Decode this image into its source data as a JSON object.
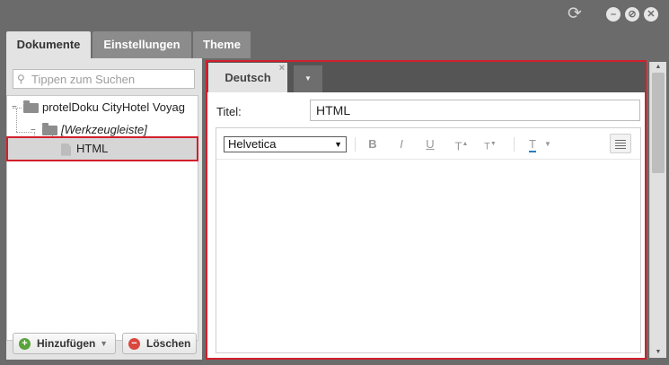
{
  "window": {
    "refresh_icon": "refresh-icon",
    "minimize_glyph": "–",
    "restore_glyph": "⊘",
    "close_glyph": "✕"
  },
  "tabs": [
    {
      "label": "Dokumente",
      "active": true
    },
    {
      "label": "Einstellungen",
      "active": false
    },
    {
      "label": "Theme",
      "active": false
    }
  ],
  "sidebar": {
    "search_placeholder": "Tippen zum Suchen",
    "tree": {
      "root_label": "protelDoku CityHotel Voyag",
      "folder_label": "[Werkzeugleiste]",
      "item_label": "HTML"
    },
    "buttons": {
      "add_label": "Hinzufügen",
      "delete_label": "Löschen"
    }
  },
  "editor": {
    "language_tab": "Deutsch",
    "language_tab_close": "×",
    "title_label": "Titel:",
    "title_value": "HTML",
    "font_value": "Helvetica",
    "toolbar": {
      "bold": "B",
      "italic": "I",
      "underline": "U",
      "superscript": "T",
      "subscript": "T",
      "text_color": "T"
    }
  },
  "colors": {
    "highlight_outline": "#d21f2b",
    "text_color_underline": "#2a7fc1",
    "add_icon": "#5aa33a",
    "delete_icon": "#d9473f"
  }
}
